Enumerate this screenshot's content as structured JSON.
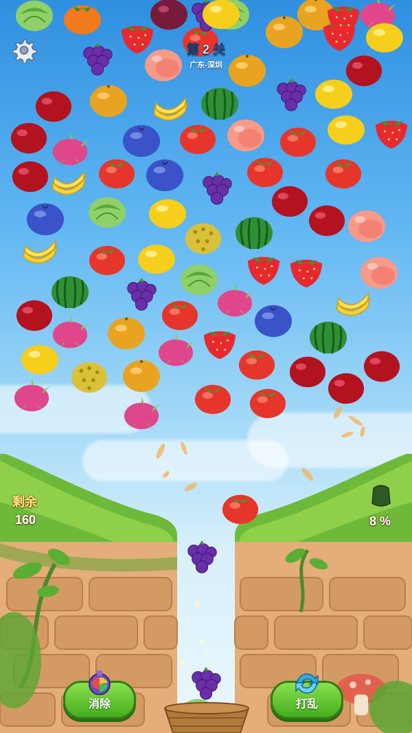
{
  "level": {
    "title": "第 2 关",
    "location": "广东-深圳"
  },
  "hud": {
    "remaining_label": "剩余",
    "remaining_count": "160",
    "progress_label": "8 %"
  },
  "buttons": {
    "clear_label": "消除",
    "shuffle_label": "打乱"
  },
  "icons": {
    "settings": "gear-icon",
    "clear": "potion-bomb-icon",
    "shuffle": "shuffle-arrows-icon",
    "progress": "melon-progress-icon"
  },
  "colors": {
    "sky_top": "#2f8fe0",
    "button_green": "#45ad1e",
    "wall_brick": "#e3ae79",
    "grass": "#6fb93a"
  },
  "fruits": [
    {
      "type": "cabbage"
    },
    {
      "type": "persimmon"
    },
    {
      "type": "grapes"
    },
    {
      "type": "strawberry"
    },
    {
      "type": "plum"
    },
    {
      "type": "cabbage"
    },
    {
      "type": "orange"
    },
    {
      "type": "dragonfruit"
    },
    {
      "type": "strawberry"
    },
    {
      "type": "tomato"
    },
    {
      "type": "lemon"
    },
    {
      "type": "grapes"
    },
    {
      "type": "orange"
    },
    {
      "type": "peach"
    },
    {
      "type": "orange"
    },
    {
      "type": "strawberry"
    },
    {
      "type": "cherry"
    },
    {
      "type": "lemon"
    },
    {
      "type": "cherry"
    },
    {
      "type": "orange"
    },
    {
      "type": "banana"
    },
    {
      "type": "watermelon"
    },
    {
      "type": "grapes"
    },
    {
      "type": "lemon"
    },
    {
      "type": "cherry"
    },
    {
      "type": "dragonfruit"
    },
    {
      "type": "blueberry"
    },
    {
      "type": "tomato"
    },
    {
      "type": "peach"
    },
    {
      "type": "tomato"
    },
    {
      "type": "lemon"
    },
    {
      "type": "strawberry"
    },
    {
      "type": "cherry"
    },
    {
      "type": "banana"
    },
    {
      "type": "tomato"
    },
    {
      "type": "blueberry"
    },
    {
      "type": "grapes"
    },
    {
      "type": "tomato"
    },
    {
      "type": "tomato"
    },
    {
      "type": "blueberry"
    },
    {
      "type": "cabbage"
    },
    {
      "type": "lemon"
    },
    {
      "type": "durian"
    },
    {
      "type": "watermelon"
    },
    {
      "type": "cherry"
    },
    {
      "type": "cherry"
    },
    {
      "type": "peach"
    },
    {
      "type": "banana"
    },
    {
      "type": "tomato"
    },
    {
      "type": "lemon"
    },
    {
      "type": "strawberry"
    },
    {
      "type": "strawberry"
    },
    {
      "type": "peach"
    },
    {
      "type": "watermelon"
    },
    {
      "type": "grapes"
    },
    {
      "type": "cabbage"
    },
    {
      "type": "dragonfruit"
    },
    {
      "type": "banana"
    },
    {
      "type": "cherry"
    },
    {
      "type": "tomato"
    },
    {
      "type": "blueberry"
    },
    {
      "type": "dragonfruit"
    },
    {
      "type": "orange"
    },
    {
      "type": "dragonfruit"
    },
    {
      "type": "strawberry"
    },
    {
      "type": "watermelon"
    },
    {
      "type": "lemon"
    },
    {
      "type": "tomato"
    },
    {
      "type": "cherry"
    },
    {
      "type": "cherry"
    },
    {
      "type": "durian"
    },
    {
      "type": "orange"
    },
    {
      "type": "dragonfruit"
    },
    {
      "type": "cherry"
    },
    {
      "type": "dragonfruit"
    },
    {
      "type": "tomato"
    },
    {
      "type": "tomato"
    },
    {
      "type": "tomato"
    },
    {
      "type": "grapes"
    },
    {
      "type": "grapes"
    },
    {
      "type": "cabbage"
    }
  ]
}
